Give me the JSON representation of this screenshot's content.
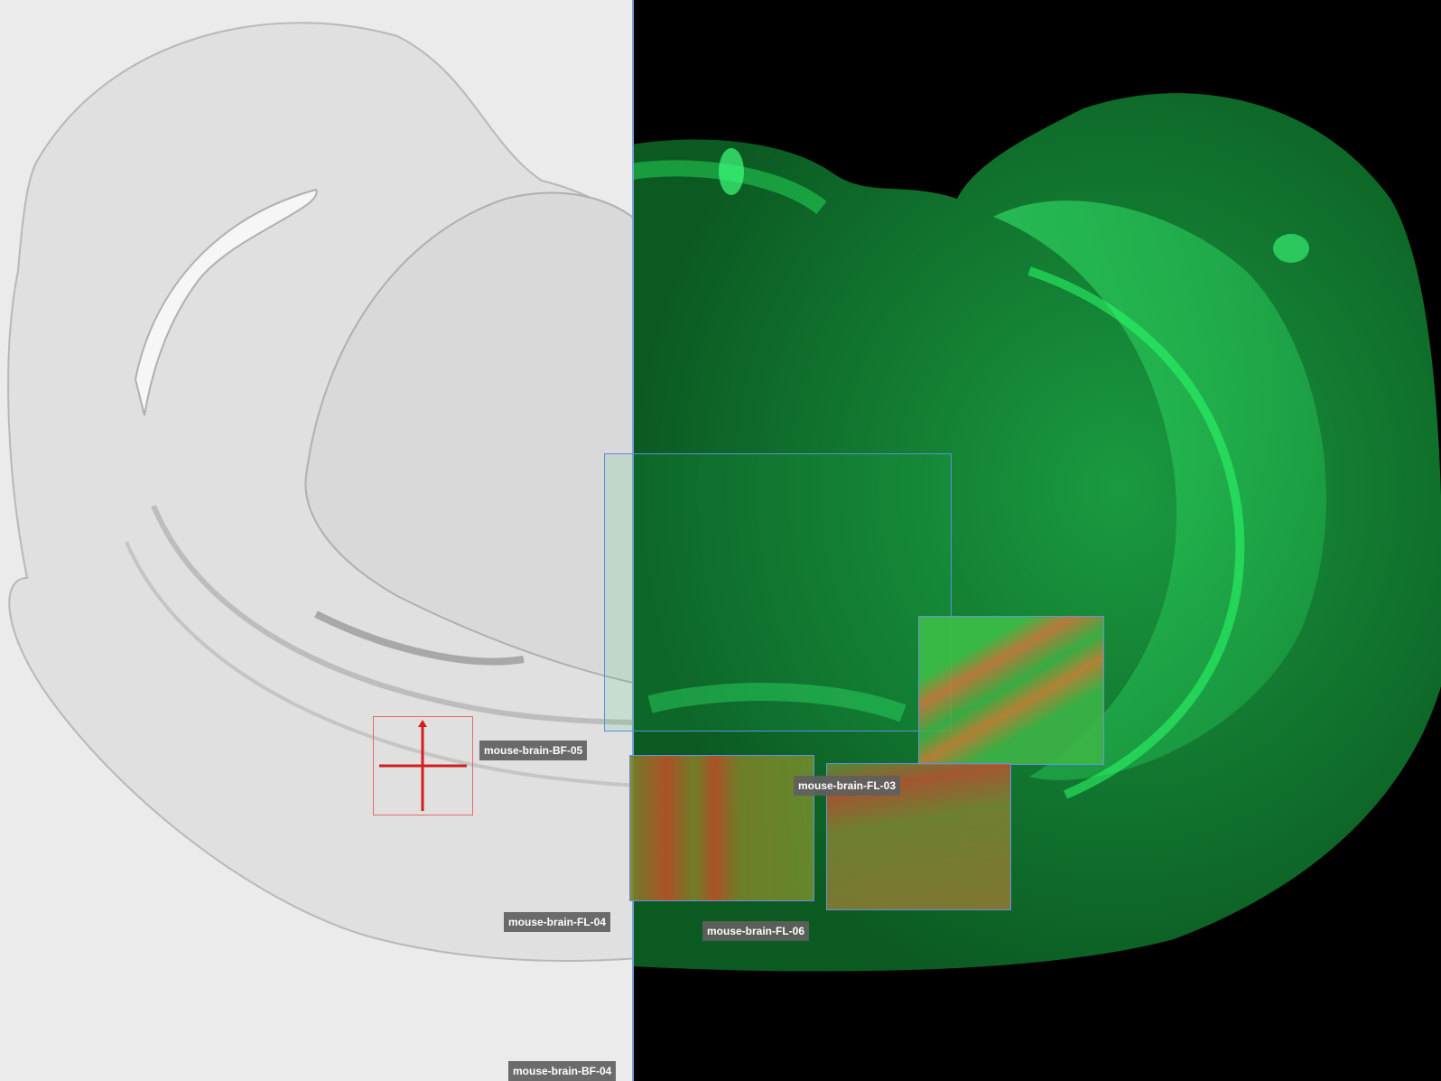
{
  "viewer": {
    "labels": {
      "bf05": "mouse-brain-BF-05",
      "fl03": "mouse-brain-FL-03",
      "fl04": "mouse-brain-FL-04",
      "fl06": "mouse-brain-FL-06",
      "bf04": "mouse-brain-BF-04"
    },
    "colors": {
      "brightfield_bg": "#eeeeee",
      "fluorescence": "#1fd65a",
      "tile_border": "#5a8fe6",
      "selection": "#e86a6a"
    },
    "icons": {
      "crosshair": "move-crosshair-icon"
    }
  }
}
